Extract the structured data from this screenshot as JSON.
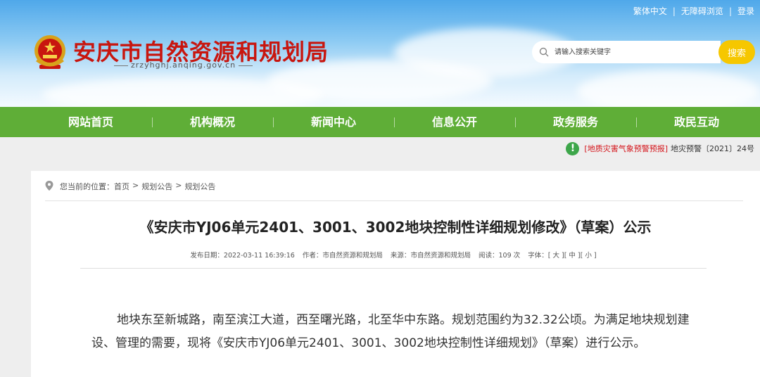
{
  "top_links": {
    "traditional": "繁体中文",
    "accessible": "无障碍浏览",
    "login": "登录",
    "separator": "|"
  },
  "site": {
    "title": "安庆市自然资源和规划局",
    "domain": "zrzyhghj.anqing.gov.cn"
  },
  "search": {
    "placeholder": "请输入搜索关键字",
    "button_label": "搜索"
  },
  "nav": {
    "items": [
      {
        "label": "网站首页"
      },
      {
        "label": "机构概况"
      },
      {
        "label": "新闻中心"
      },
      {
        "label": "信息公开"
      },
      {
        "label": "政务服务"
      },
      {
        "label": "政民互动"
      }
    ]
  },
  "alert": {
    "icon": "!",
    "tag": "[地质灾害气象预警预报]",
    "text": "地灾预警〔2021〕24号"
  },
  "breadcrumb": {
    "prefix": "您当前的位置：",
    "home": "首页",
    "separator": ">",
    "level1": "规划公告",
    "level2": "规划公告"
  },
  "article": {
    "title": "《安庆市YJ06单元2401、3001、3002地块控制性详细规划修改》（草案）公示",
    "meta": {
      "date_label": "发布日期：",
      "date": "2022-03-11 16:39:16",
      "author_label": "作者：",
      "author": "市自然资源和规划局",
      "source_label": "来源：",
      "source": "市自然资源和规划局",
      "views_label": "阅读：",
      "views": "109",
      "views_unit": "次",
      "fontsize_label": "字体：",
      "size_large": "[ 大 ]",
      "size_medium": "[ 中 ]",
      "size_small": "[ 小 ]"
    },
    "body": "地块东至新城路，南至滨江大道，西至曙光路，北至华中东路。规划范围约为32.32公顷。为满足地块规划建设、管理的需要，现将《安庆市YJ06单元2401、3001、3002地块控制性详细规划》（草案）进行公示。"
  },
  "colors": {
    "brand_red": "#c8160f",
    "nav_green": "#5fae37",
    "search_yellow": "#f6c700",
    "alert_red": "#d4141a",
    "alert_green": "#3da64a"
  }
}
